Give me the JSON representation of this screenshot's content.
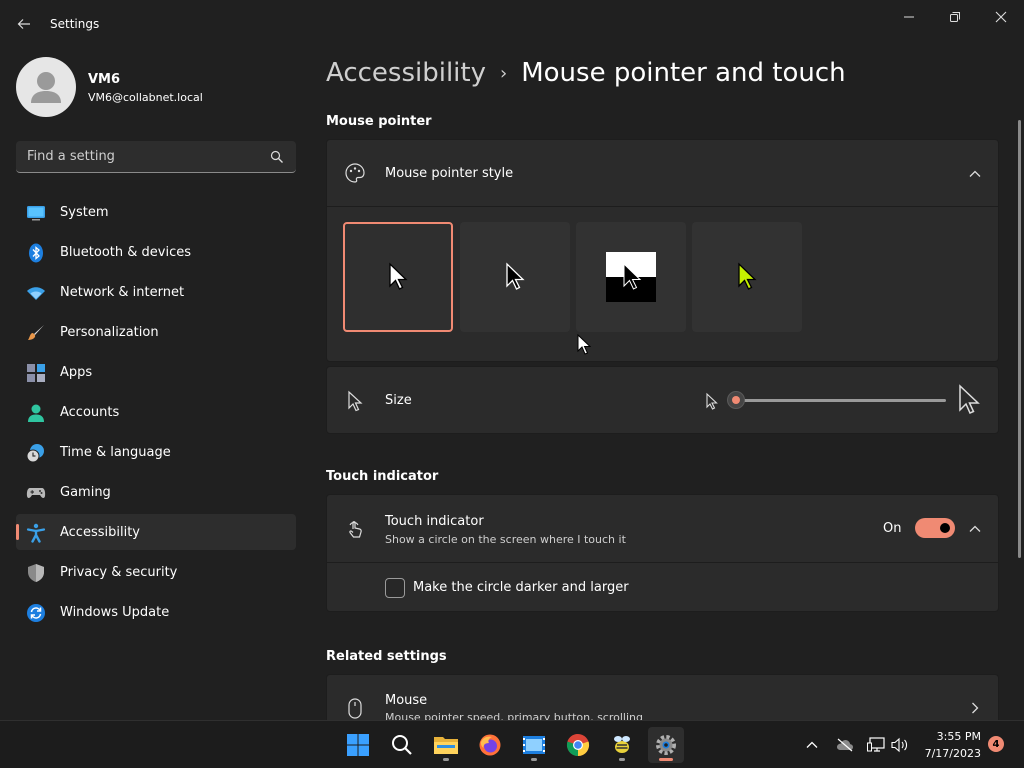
{
  "window": {
    "title": "Settings",
    "back_icon": "back-arrow-icon",
    "controls": [
      "minimize-icon",
      "maximize-icon",
      "close-icon"
    ]
  },
  "profile": {
    "name": "VM6",
    "email": "VM6@collabnet.local"
  },
  "search": {
    "placeholder": "Find a setting",
    "icon": "search-icon"
  },
  "sidebar": {
    "items": [
      {
        "label": "System",
        "icon": "system-icon"
      },
      {
        "label": "Bluetooth & devices",
        "icon": "bluetooth-icon"
      },
      {
        "label": "Network & internet",
        "icon": "network-icon"
      },
      {
        "label": "Personalization",
        "icon": "brush-icon"
      },
      {
        "label": "Apps",
        "icon": "apps-icon"
      },
      {
        "label": "Accounts",
        "icon": "person-icon"
      },
      {
        "label": "Time & language",
        "icon": "clock-globe-icon"
      },
      {
        "label": "Gaming",
        "icon": "gamepad-icon"
      },
      {
        "label": "Accessibility",
        "icon": "accessibility-icon",
        "active": true
      },
      {
        "label": "Privacy & security",
        "icon": "shield-icon"
      },
      {
        "label": "Windows Update",
        "icon": "update-icon"
      }
    ]
  },
  "breadcrumb": {
    "parent": "Accessibility",
    "separator": "›",
    "current": "Mouse pointer and touch"
  },
  "mouse_pointer": {
    "section_title": "Mouse pointer",
    "style_card": {
      "label": "Mouse pointer style",
      "icon": "palette-icon",
      "expanded": true,
      "styles": [
        "white",
        "black",
        "inverted",
        "custom"
      ],
      "selected": "white"
    },
    "size_card": {
      "label": "Size",
      "icon": "pointer-icon",
      "value_fraction": 0.0
    }
  },
  "touch": {
    "section_title": "Touch indicator",
    "card": {
      "label": "Touch indicator",
      "description": "Show a circle on the screen where I touch it",
      "icon": "touch-icon",
      "toggle_label": "On",
      "toggle_on": true
    },
    "option": {
      "label": "Make the circle darker and larger",
      "checked": false
    }
  },
  "related": {
    "section_title": "Related settings",
    "mouse": {
      "label": "Mouse",
      "description": "Mouse pointer speed, primary button, scrolling",
      "icon": "mouse-icon"
    }
  },
  "taskbar": {
    "apps": [
      "start-icon",
      "search-icon",
      "file-explorer-icon",
      "firefox-icon",
      "film-icon",
      "chrome-icon",
      "bee-app-icon",
      "settings-gear-icon"
    ],
    "tray": [
      "chevron-up-icon",
      "cloud-off-icon",
      "network-display-icon",
      "volume-icon"
    ],
    "time": "3:55 PM",
    "date": "7/17/2023",
    "notifications": "4"
  },
  "colors": {
    "accent": "#f08a73",
    "background": "#202020",
    "card": "#2b2b2b"
  }
}
